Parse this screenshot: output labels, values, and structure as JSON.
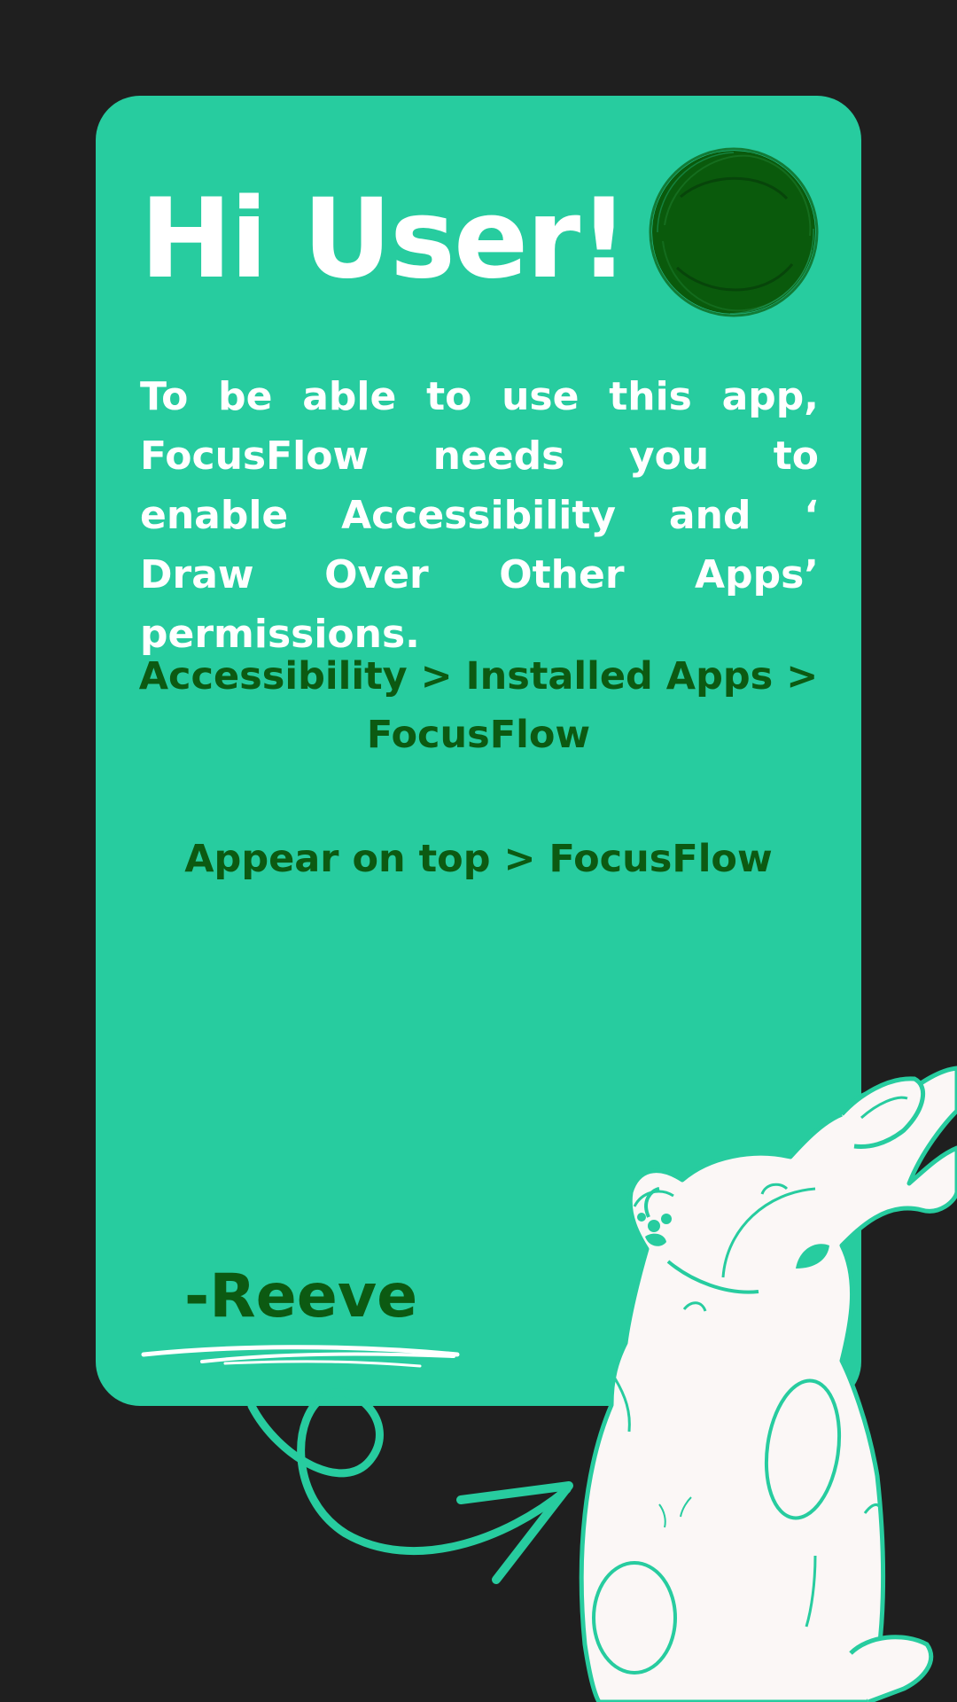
{
  "card": {
    "greeting": "Hi User!",
    "intro": "To be able to use this app, FocusFlow needs you to enable Accessibility and ‘ Draw Over Other  Apps’ permissions.",
    "accessibility_path": "Accessibility > Installed Apps > FocusFlow",
    "overlay_path": "Appear on top > FocusFlow",
    "signature": "-Reeve"
  },
  "icons": {
    "avatar": "avatar-icon",
    "underline": "scribble-underline-icon",
    "arrow": "curved-arrow-icon",
    "mascot": "bunny-illustration"
  },
  "colors": {
    "background": "#1f1f1f",
    "card": "#27cc9f",
    "heading_text": "#ffffff",
    "accent_text": "#0c5a12",
    "avatar": "#0a5a0c",
    "bunny_fill": "#fbf7f6"
  }
}
